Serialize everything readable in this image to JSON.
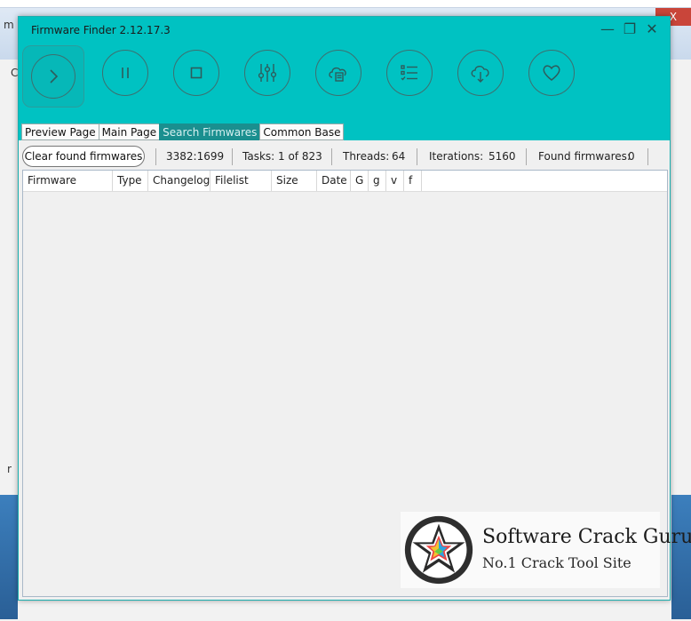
{
  "background": {
    "close_glyph": "X",
    "frag_c": "C",
    "frag_m": "m",
    "frag_r": "r"
  },
  "window": {
    "title": "Firmware Finder 2.12.17.3",
    "minimize_glyph": "—",
    "restore_glyph": "❐",
    "close_glyph": "✕"
  },
  "toolbar": [
    {
      "name": "play-icon"
    },
    {
      "name": "pause-icon"
    },
    {
      "name": "stop-icon"
    },
    {
      "name": "sliders-icon"
    },
    {
      "name": "cloud-document-icon"
    },
    {
      "name": "checklist-icon"
    },
    {
      "name": "cloud-download-icon"
    },
    {
      "name": "heart-icon"
    }
  ],
  "tabs": [
    {
      "label": "Preview Page",
      "selected": false
    },
    {
      "label": "Main Page",
      "selected": false
    },
    {
      "label": "Search Firmwares",
      "selected": true
    },
    {
      "label": "Common Base",
      "selected": false
    }
  ],
  "status": {
    "clear_button": "Clear found firmwares",
    "ratio": "3382:1699",
    "tasks_label": "Tasks:",
    "tasks_value": "1 of 823",
    "threads_label": "Threads:",
    "threads_value": "64",
    "iterations_label": "Iterations:",
    "iterations_value": "5160",
    "found_label": "Found firmwares:",
    "found_value": "0"
  },
  "grid": {
    "columns": [
      "Firmware",
      "Type",
      "Changelog",
      "Filelist",
      "Size",
      "Date",
      "G",
      "g",
      "v",
      "f"
    ]
  },
  "watermark": {
    "title": "Software Crack Guru",
    "subtitle": "No.1 Crack Tool Site"
  },
  "colors": {
    "accent": "#00c2c2",
    "tab_selected": "#1a8f8f"
  }
}
